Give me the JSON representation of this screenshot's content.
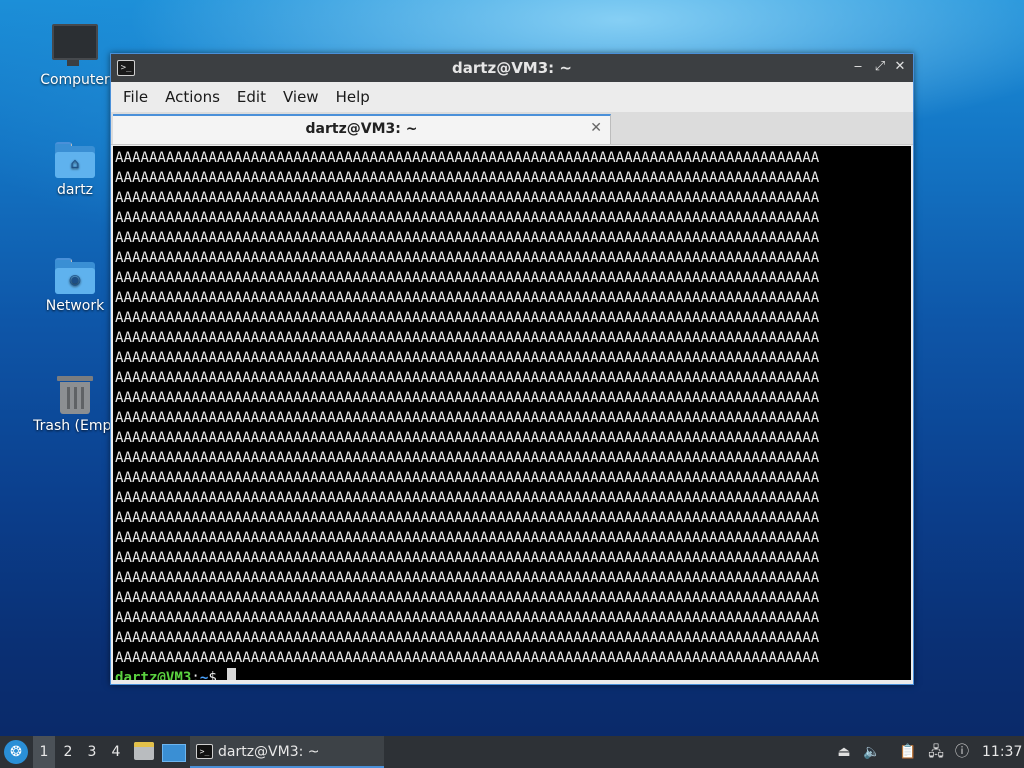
{
  "desktop": {
    "icons": [
      {
        "label": "Computer",
        "icon": "computer-icon"
      },
      {
        "label": "dartz",
        "icon": "home-folder-icon"
      },
      {
        "label": "Network",
        "icon": "network-folder-icon"
      },
      {
        "label": "Trash (Empt",
        "icon": "trash-icon"
      }
    ]
  },
  "window": {
    "title": "dartz@VM3: ~",
    "controls": {
      "minimize": "‒",
      "maximize": "⤢",
      "close": "✕"
    },
    "menu": [
      "File",
      "Actions",
      "Edit",
      "View",
      "Help"
    ],
    "tab": {
      "label": "dartz@VM3: ~",
      "close": "✕"
    }
  },
  "terminal": {
    "lines": [
      "AAAAAAAAAAAAAAAAAAAAAAAAAAAAAAAAAAAAAAAAAAAAAAAAAAAAAAAAAAAAAAAAAAAAAAAAAAAAAAAAAAA",
      "AAAAAAAAAAAAAAAAAAAAAAAAAAAAAAAAAAAAAAAAAAAAAAAAAAAAAAAAAAAAAAAAAAAAAAAAAAAAAAAAAAA",
      "AAAAAAAAAAAAAAAAAAAAAAAAAAAAAAAAAAAAAAAAAAAAAAAAAAAAAAAAAAAAAAAAAAAAAAAAAAAAAAAAAAA",
      "AAAAAAAAAAAAAAAAAAAAAAAAAAAAAAAAAAAAAAAAAAAAAAAAAAAAAAAAAAAAAAAAAAAAAAAAAAAAAAAAAAA",
      "AAAAAAAAAAAAAAAAAAAAAAAAAAAAAAAAAAAAAAAAAAAAAAAAAAAAAAAAAAAAAAAAAAAAAAAAAAAAAAAAAAA",
      "AAAAAAAAAAAAAAAAAAAAAAAAAAAAAAAAAAAAAAAAAAAAAAAAAAAAAAAAAAAAAAAAAAAAAAAAAAAAAAAAAAA",
      "AAAAAAAAAAAAAAAAAAAAAAAAAAAAAAAAAAAAAAAAAAAAAAAAAAAAAAAAAAAAAAAAAAAAAAAAAAAAAAAAAAA",
      "AAAAAAAAAAAAAAAAAAAAAAAAAAAAAAAAAAAAAAAAAAAAAAAAAAAAAAAAAAAAAAAAAAAAAAAAAAAAAAAAAAA",
      "AAAAAAAAAAAAAAAAAAAAAAAAAAAAAAAAAAAAAAAAAAAAAAAAAAAAAAAAAAAAAAAAAAAAAAAAAAAAAAAAAAA",
      "AAAAAAAAAAAAAAAAAAAAAAAAAAAAAAAAAAAAAAAAAAAAAAAAAAAAAAAAAAAAAAAAAAAAAAAAAAAAAAAAAAA",
      "AAAAAAAAAAAAAAAAAAAAAAAAAAAAAAAAAAAAAAAAAAAAAAAAAAAAAAAAAAAAAAAAAAAAAAAAAAAAAAAAAAA",
      "AAAAAAAAAAAAAAAAAAAAAAAAAAAAAAAAAAAAAAAAAAAAAAAAAAAAAAAAAAAAAAAAAAAAAAAAAAAAAAAAAAA",
      "AAAAAAAAAAAAAAAAAAAAAAAAAAAAAAAAAAAAAAAAAAAAAAAAAAAAAAAAAAAAAAAAAAAAAAAAAAAAAAAAAAA",
      "AAAAAAAAAAAAAAAAAAAAAAAAAAAAAAAAAAAAAAAAAAAAAAAAAAAAAAAAAAAAAAAAAAAAAAAAAAAAAAAAAAA",
      "AAAAAAAAAAAAAAAAAAAAAAAAAAAAAAAAAAAAAAAAAAAAAAAAAAAAAAAAAAAAAAAAAAAAAAAAAAAAAAAAAAA",
      "AAAAAAAAAAAAAAAAAAAAAAAAAAAAAAAAAAAAAAAAAAAAAAAAAAAAAAAAAAAAAAAAAAAAAAAAAAAAAAAAAAA",
      "AAAAAAAAAAAAAAAAAAAAAAAAAAAAAAAAAAAAAAAAAAAAAAAAAAAAAAAAAAAAAAAAAAAAAAAAAAAAAAAAAAA",
      "AAAAAAAAAAAAAAAAAAAAAAAAAAAAAAAAAAAAAAAAAAAAAAAAAAAAAAAAAAAAAAAAAAAAAAAAAAAAAAAAAAA",
      "AAAAAAAAAAAAAAAAAAAAAAAAAAAAAAAAAAAAAAAAAAAAAAAAAAAAAAAAAAAAAAAAAAAAAAAAAAAAAAAAAAA",
      "AAAAAAAAAAAAAAAAAAAAAAAAAAAAAAAAAAAAAAAAAAAAAAAAAAAAAAAAAAAAAAAAAAAAAAAAAAAAAAAAAAA",
      "AAAAAAAAAAAAAAAAAAAAAAAAAAAAAAAAAAAAAAAAAAAAAAAAAAAAAAAAAAAAAAAAAAAAAAAAAAAAAAAAAAA",
      "AAAAAAAAAAAAAAAAAAAAAAAAAAAAAAAAAAAAAAAAAAAAAAAAAAAAAAAAAAAAAAAAAAAAAAAAAAAAAAAAAAA",
      "AAAAAAAAAAAAAAAAAAAAAAAAAAAAAAAAAAAAAAAAAAAAAAAAAAAAAAAAAAAAAAAAAAAAAAAAAAAAAAAAAAA",
      "AAAAAAAAAAAAAAAAAAAAAAAAAAAAAAAAAAAAAAAAAAAAAAAAAAAAAAAAAAAAAAAAAAAAAAAAAAAAAAAAAAA",
      "AAAAAAAAAAAAAAAAAAAAAAAAAAAAAAAAAAAAAAAAAAAAAAAAAAAAAAAAAAAAAAAAAAAAAAAAAAAAAAAAAAA",
      "AAAAAAAAAAAAAAAAAAAAAAAAAAAAAAAAAAAAAAAAAAAAAAAAAAAAAAAAAAAAAAAAAAAAAAAAAAAAAAAAAAA"
    ],
    "prompt": {
      "user_host": "dartz@VM3",
      "sep": ":",
      "path": "~",
      "symbol": "$ "
    }
  },
  "taskbar": {
    "start_icon": "lxqt-logo-icon",
    "workspaces": [
      "1",
      "2",
      "3",
      "4"
    ],
    "active_workspace": "1",
    "quicklaunch": [
      "file-manager-icon",
      "desktop-icon"
    ],
    "task": {
      "label": "dartz@VM3: ~",
      "icon": "terminal-icon"
    },
    "tray": [
      "removable-media-icon",
      "volume-icon",
      "clipboard-icon",
      "network-icon",
      "update-notifier-icon"
    ],
    "clock": "11:37"
  },
  "colors": {
    "accent": "#4a90d9",
    "prompt_user": "#5ad13f",
    "prompt_path": "#4aa3ff",
    "terminal_bg": "#000000",
    "taskbar_bg": "#2d3136"
  }
}
